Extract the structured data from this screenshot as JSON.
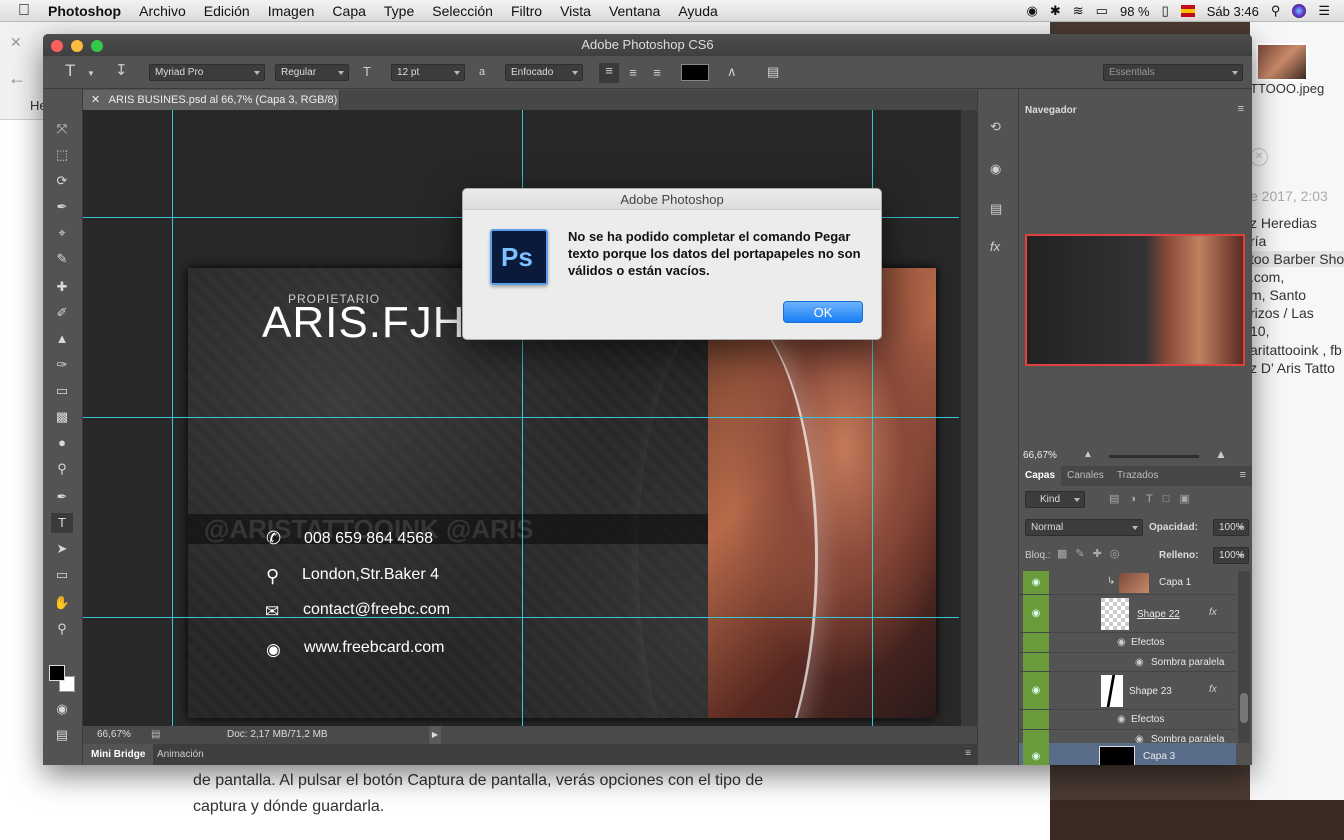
{
  "menubar": {
    "apple": "",
    "app": "Photoshop",
    "items": [
      "Archivo",
      "Edición",
      "Imagen",
      "Capa",
      "Type",
      "Selección",
      "Filtro",
      "Vista",
      "Ventana",
      "Ayuda"
    ],
    "battery": "98 %",
    "clock": "Sáb 3:46"
  },
  "browser": {
    "article_lines": [
      "de pantalla. Al pulsar el botón Captura de pantalla, verás opciones con el tipo de",
      "captura y dónde guardarla."
    ],
    "tab_fragment": "He"
  },
  "right_doc": {
    "filename": "TTOOO.jpeg",
    "date": "e 2017, 2:03",
    "lines": [
      "z Heredias",
      "ría",
      "too Barber Sho",
      ".com,",
      "m, Santo",
      "rizos / Las",
      "10,",
      "aritattooink , fb",
      "z  D' Aris Tatto"
    ]
  },
  "photoshop": {
    "window_title": "Adobe Photoshop CS6",
    "options": {
      "font_family": "Myriad Pro",
      "font_style": "Regular",
      "font_size": "12 pt",
      "aa_label": "a",
      "antialias": "Enfocado",
      "workspace": "Essentials",
      "text_color": "#000000"
    },
    "document_tab": "ARIS BUSINES.psd al 66,7% (Capa 3, RGB/8) *",
    "status": {
      "zoom": "66,67%",
      "doc": "Doc: 2,17 MB/71,2 MB"
    },
    "bottom_tabs": [
      "Mini Bridge",
      "Animación"
    ],
    "card": {
      "owner_label": "PROPIETARIO",
      "name": "ARIS.FJH",
      "watermark": "@ARISTATTOOINK  @ARIS",
      "phone": "008 659 864 4568",
      "address": "London,Str.Baker 4",
      "email": "contact@freebc.com",
      "web": "www.freebcard.com"
    },
    "navigator": {
      "title": "Navegador",
      "zoom": "66,67%"
    },
    "layers_panel": {
      "tabs": [
        "Capas",
        "Canales",
        "Trazados"
      ],
      "kind": "Kind",
      "blend": "Normal",
      "opacity_label": "Opacidad:",
      "opacity": "100%",
      "lock_label": "Bloq.:",
      "fill_label": "Relleno:",
      "fill": "100%",
      "layers": [
        {
          "name": "Capa 1"
        },
        {
          "name": "Shape 22",
          "effects": "Efectos",
          "effect": "Sombra paralela"
        },
        {
          "name": "Shape 23",
          "effects": "Efectos",
          "effect": "Sombra paralela"
        },
        {
          "name": "Capa 3"
        }
      ]
    }
  },
  "dialog": {
    "title": "Adobe Photoshop",
    "message": "No se ha podido completar el comando Pegar texto porque los datos del portapapeles no son válidos o están vacíos.",
    "ok": "OK",
    "icon_text": "Ps"
  }
}
